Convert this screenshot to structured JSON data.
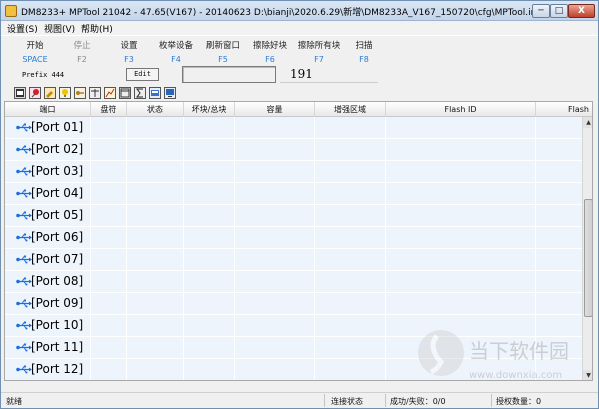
{
  "window": {
    "title": "DM8233+ MPTool 21042 - 47.65(V167) - 20140623  D:\\bianji\\2020.6.29\\新增\\DM8233A_V167_150720\\cfg\\MPTool.ini",
    "min_glyph": "─",
    "max_glyph": "□",
    "close_glyph": "X"
  },
  "menu": [
    {
      "label": "设置(S)"
    },
    {
      "label": "视图(V)"
    },
    {
      "label": "帮助(H)"
    }
  ],
  "toolbar": [
    {
      "label": "开始",
      "key": "SPACE",
      "enabled": true
    },
    {
      "label": "停止",
      "key": "F2",
      "enabled": false
    },
    {
      "label": "设置",
      "key": "F3",
      "enabled": true
    },
    {
      "label": "枚举设备",
      "key": "F4",
      "enabled": true
    },
    {
      "label": "刷新窗口",
      "key": "F5",
      "enabled": true
    },
    {
      "label": "擦除好块",
      "key": "F6",
      "enabled": true
    },
    {
      "label": "擦除所有块",
      "key": "F7",
      "enabled": true
    },
    {
      "label": "扫描",
      "key": "F8",
      "enabled": true
    }
  ],
  "prefix": {
    "label": "Prefix  444",
    "edit_button": "Edit",
    "counter": "191"
  },
  "columns": [
    "端口",
    "盘符",
    "状态",
    "坏块/总块",
    "容量",
    "增强区域",
    "Flash ID",
    "Flash"
  ],
  "rows": [
    {
      "port": "[Port 01]"
    },
    {
      "port": "[Port 02]"
    },
    {
      "port": "[Port 03]"
    },
    {
      "port": "[Port 04]"
    },
    {
      "port": "[Port 05]"
    },
    {
      "port": "[Port 06]"
    },
    {
      "port": "[Port 07]"
    },
    {
      "port": "[Port 08]"
    },
    {
      "port": "[Port 09]"
    },
    {
      "port": "[Port 10]"
    },
    {
      "port": "[Port 11]"
    },
    {
      "port": "[Port 12]"
    }
  ],
  "status": {
    "ready": "就绪",
    "connection": "连接状态",
    "result": "成功/失败：0/0",
    "license": "授权数量：0"
  },
  "watermark": {
    "brand": "当下软件园",
    "url": "www.downxia.com"
  },
  "colors": {
    "key_blue": "#2d7bd6",
    "row_bg": "#eef4fb",
    "usb_blue": "#1e6fd8"
  }
}
